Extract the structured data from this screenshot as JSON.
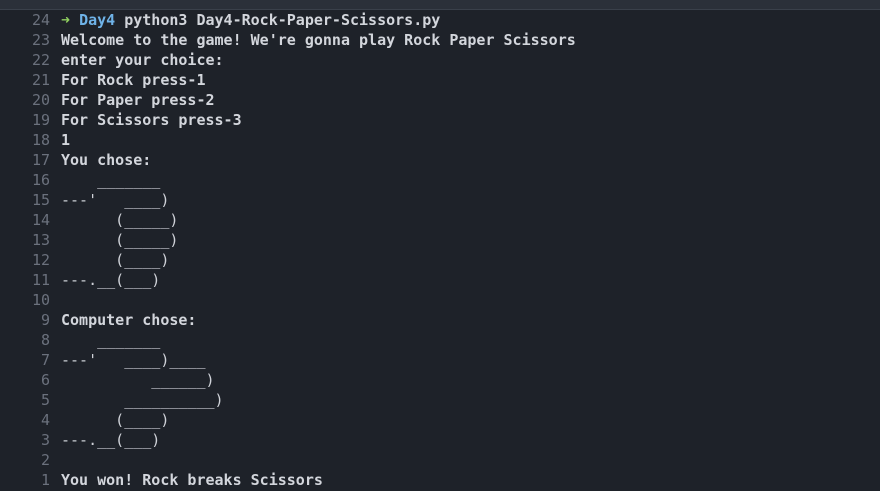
{
  "prompt": {
    "arrow": "➜",
    "dir": "Day4",
    "command": "python3 Day4-Rock-Paper-Scissors.py"
  },
  "lines": [
    {
      "num": "24",
      "text": "",
      "kind": "prompt"
    },
    {
      "num": "23",
      "text": "Welcome to the game! We're gonna play Rock Paper Scissors",
      "kind": "text"
    },
    {
      "num": "22",
      "text": "enter your choice:",
      "kind": "text"
    },
    {
      "num": "21",
      "text": "For Rock press-1",
      "kind": "text"
    },
    {
      "num": "20",
      "text": "For Paper press-2",
      "kind": "text"
    },
    {
      "num": "19",
      "text": "For Scissors press-3",
      "kind": "text"
    },
    {
      "num": "18",
      "text": "1",
      "kind": "text"
    },
    {
      "num": "17",
      "text": "You chose:",
      "kind": "text"
    },
    {
      "num": "16",
      "text": "    _______",
      "kind": "art"
    },
    {
      "num": "15",
      "text": "---'   ____)",
      "kind": "art"
    },
    {
      "num": "14",
      "text": "      (_____)",
      "kind": "art"
    },
    {
      "num": "13",
      "text": "      (_____)",
      "kind": "art"
    },
    {
      "num": "12",
      "text": "      (____)",
      "kind": "art"
    },
    {
      "num": "11",
      "text": "---.__(___)",
      "kind": "art"
    },
    {
      "num": "10",
      "text": "",
      "kind": "text"
    },
    {
      "num": "9",
      "text": "Computer chose:",
      "kind": "text"
    },
    {
      "num": "8",
      "text": "    _______",
      "kind": "art"
    },
    {
      "num": "7",
      "text": "---'   ____)____",
      "kind": "art"
    },
    {
      "num": "6",
      "text": "          ______)",
      "kind": "art"
    },
    {
      "num": "5",
      "text": "       __________)",
      "kind": "art"
    },
    {
      "num": "4",
      "text": "      (____)",
      "kind": "art"
    },
    {
      "num": "3",
      "text": "---.__(___)",
      "kind": "art"
    },
    {
      "num": "2",
      "text": "",
      "kind": "text"
    },
    {
      "num": "1",
      "text": "You won! Rock breaks Scissors",
      "kind": "text"
    }
  ],
  "colors": {
    "background": "#1e2229",
    "gutter": "#6b717d",
    "text": "#d3d6dc",
    "prompt_arrow": "#8fcf5f",
    "prompt_dir": "#6fb3e8"
  }
}
